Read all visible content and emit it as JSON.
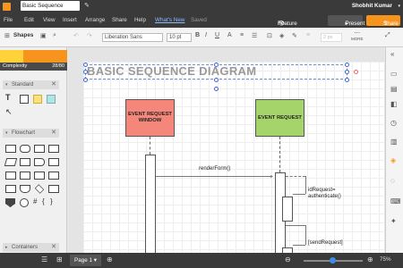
{
  "titlebar": {
    "doc_title": "Basic Sequence Diagram",
    "user": "Shobhit Kumar",
    "user_caret": "▾"
  },
  "menu": {
    "items": [
      "File",
      "Edit",
      "View",
      "Insert",
      "Arrange",
      "Share",
      "Help"
    ],
    "whats_new": "What's New",
    "saved": "Saved",
    "feature_find": "Feature Find",
    "present": "Present",
    "share": "Share"
  },
  "toolbar": {
    "font": "Liberation Sans",
    "size": "10 pt",
    "line_width": "2 px",
    "more": "MORE"
  },
  "left": {
    "shapes_label": "Shapes",
    "complexity_label": "Complexity",
    "complexity_value": "28/80",
    "complexity_fraction": 0.35,
    "sections": [
      "Standard",
      "Flowchart",
      "Containers"
    ]
  },
  "diagram": {
    "title": "BASIC SEQUENCE DIAGRAM",
    "actor1": {
      "label": "EVENT REQUEST WINDOW",
      "color": "#f5877a"
    },
    "actor2": {
      "label": "EVENT REQUEST",
      "color": "#a5d46a"
    },
    "messages": [
      "renderForm()",
      "idRequest= authenticate()",
      "[sendRequest]"
    ]
  },
  "bottom": {
    "page": "Page 1",
    "page_caret": "▾",
    "zoom": "75%"
  },
  "colors": {
    "accent": "#f7941d",
    "complexity": "#ffd23a",
    "selection": "#3b66d8"
  }
}
